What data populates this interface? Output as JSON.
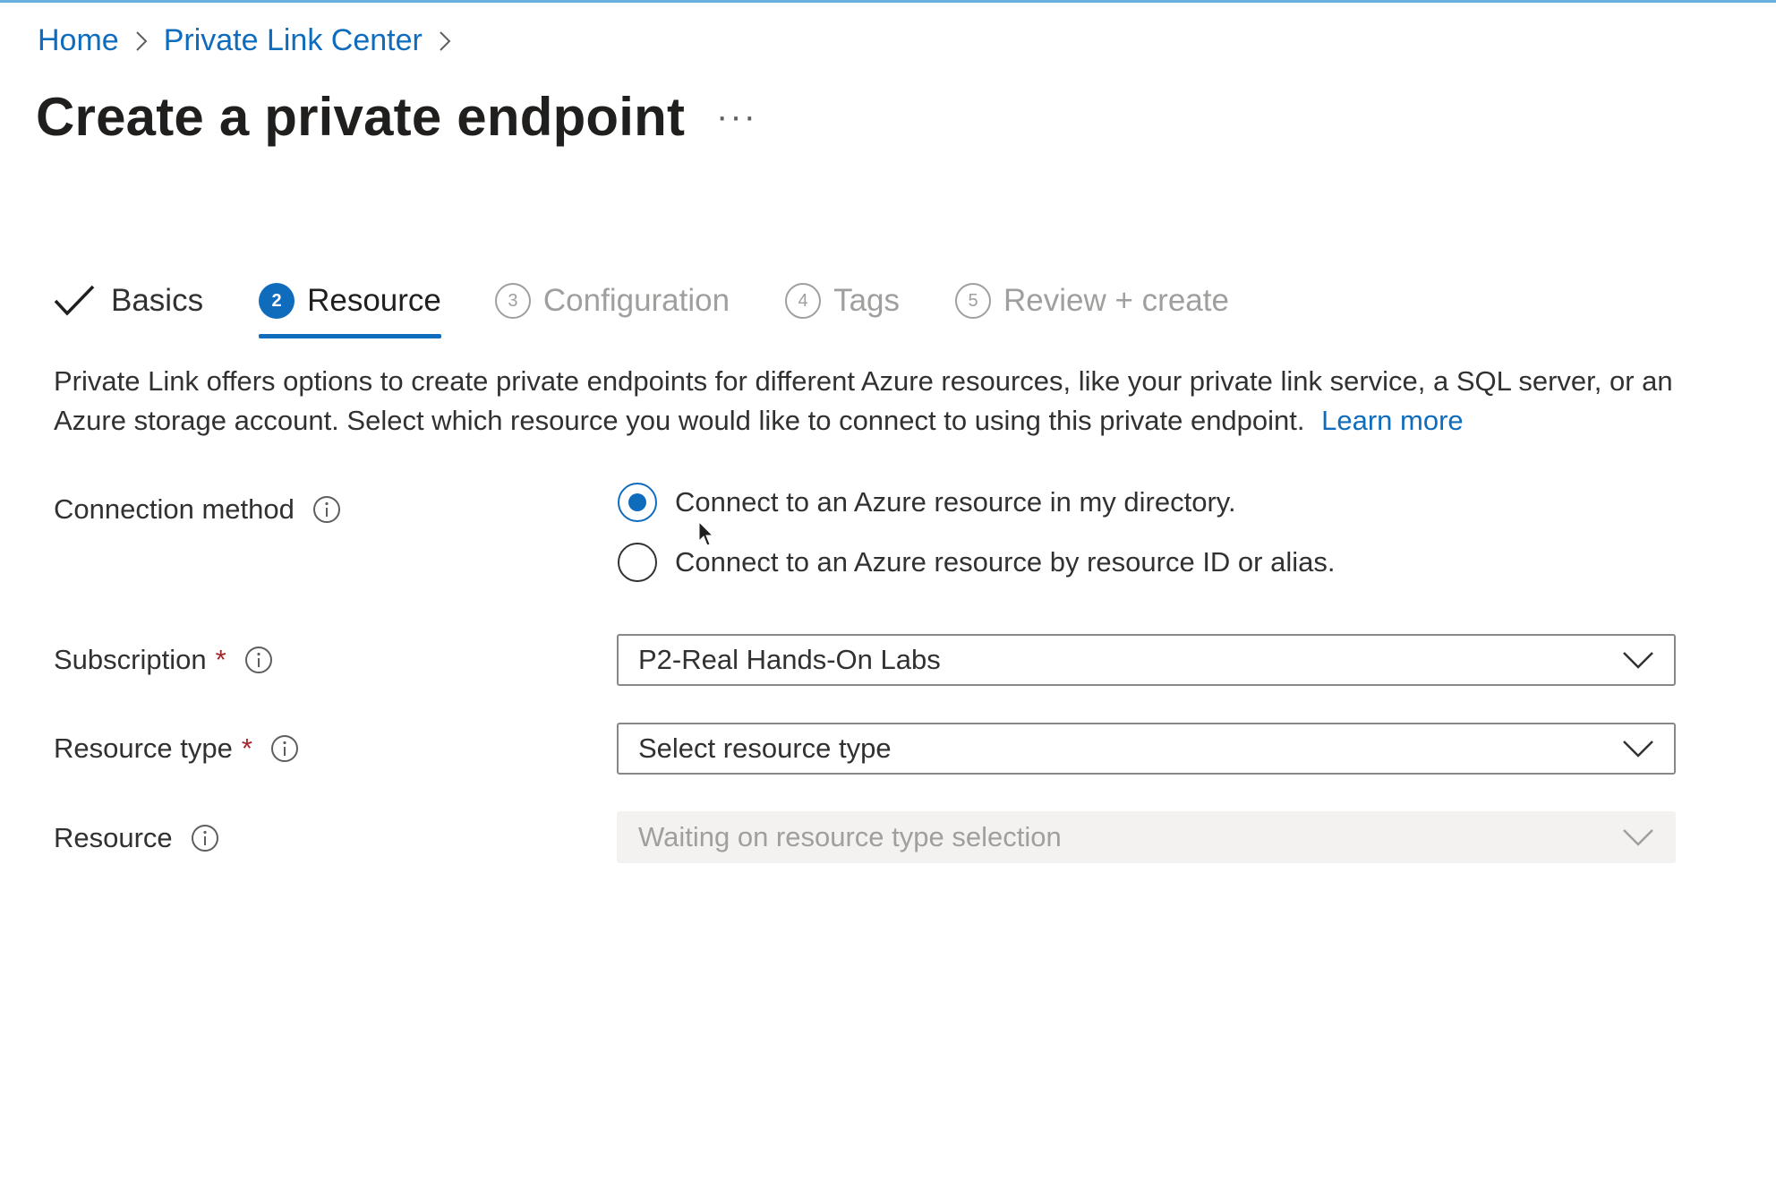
{
  "breadcrumb": {
    "items": [
      {
        "label": "Home"
      },
      {
        "label": "Private Link Center"
      }
    ]
  },
  "page": {
    "title": "Create a private endpoint",
    "more_label": "···"
  },
  "tabs": [
    {
      "label": "Basics",
      "state": "done",
      "icon": "checkmark-icon"
    },
    {
      "label": "Resource",
      "number": "2",
      "state": "active"
    },
    {
      "label": "Configuration",
      "number": "3",
      "state": "future"
    },
    {
      "label": "Tags",
      "number": "4",
      "state": "future"
    },
    {
      "label": "Review + create",
      "number": "5",
      "state": "future"
    }
  ],
  "description": {
    "text": "Private Link offers options to create private endpoints for different Azure resources, like your private link service, a SQL server, or an Azure storage account. Select which resource you would like to connect to using this private endpoint.",
    "link": "Learn more"
  },
  "form": {
    "connection_method": {
      "label": "Connection method",
      "options": [
        {
          "label": "Connect to an Azure resource in my directory.",
          "selected": true
        },
        {
          "label": "Connect to an Azure resource by resource ID or alias.",
          "selected": false
        }
      ]
    },
    "subscription": {
      "label": "Subscription",
      "required": "*",
      "value": "P2-Real Hands-On Labs"
    },
    "resource_type": {
      "label": "Resource type",
      "required": "*",
      "value": "Select resource type"
    },
    "resource": {
      "label": "Resource",
      "value": "Waiting on resource type selection",
      "disabled": true
    }
  },
  "colors": {
    "accent": "#0f6cbd",
    "required": "#a4262c",
    "disabled_text": "#a19f9d"
  }
}
